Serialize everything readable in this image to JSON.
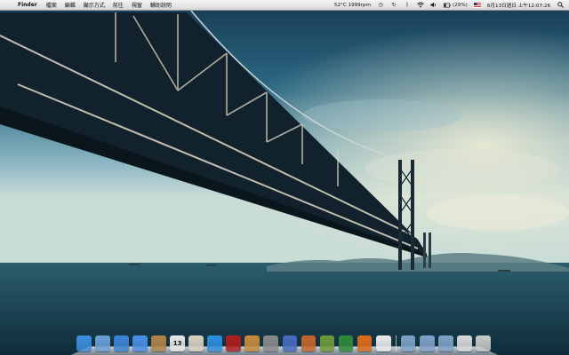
{
  "menubar": {
    "apple": "",
    "app_name": "Finder",
    "menus": [
      "檔案",
      "編輯",
      "顯示方式",
      "前往",
      "視窗",
      "輔助說明"
    ],
    "status_sensor": "52°C 1999rpm",
    "battery": "(29%)",
    "datetime": "6月13日週日 上午12:07:26"
  },
  "dock": {
    "apps": [
      {
        "name": "finder-icon",
        "color": "#3d8fe0"
      },
      {
        "name": "preview-icon",
        "color": "#6aa0d8"
      },
      {
        "name": "safari-icon",
        "color": "#3b84d6"
      },
      {
        "name": "ichat-icon",
        "color": "#4a8fe6"
      },
      {
        "name": "address-book-icon",
        "color": "#b0844a"
      },
      {
        "name": "ical-icon",
        "color": "#e8e8e8"
      },
      {
        "name": "iphoto-icon",
        "color": "#d9d2c0"
      },
      {
        "name": "itunes-icon",
        "color": "#2f8fe0"
      },
      {
        "name": "dvd-player-icon",
        "color": "#b01d1d"
      },
      {
        "name": "iphoto-library-icon",
        "color": "#c98b3d"
      },
      {
        "name": "system-preferences-icon",
        "color": "#8a8a8a"
      },
      {
        "name": "script-editor-icon",
        "color": "#4a6bbf"
      },
      {
        "name": "mail-stamp-icon",
        "color": "#c8652a"
      },
      {
        "name": "automator-icon",
        "color": "#6f9a3a"
      },
      {
        "name": "activity-monitor-icon",
        "color": "#2f8a3a"
      },
      {
        "name": "firefox-icon",
        "color": "#e06b1a"
      },
      {
        "name": "textedit-icon",
        "color": "#ececec"
      }
    ],
    "folders": [
      {
        "name": "applications-folder-icon",
        "color": "#7fa3c8"
      },
      {
        "name": "documents-folder-icon",
        "color": "#7fa3c8"
      },
      {
        "name": "downloads-folder-icon",
        "color": "#7fa3c8"
      },
      {
        "name": "screenshot-stack-icon",
        "color": "#d9d9d9"
      },
      {
        "name": "trash-icon",
        "color": "#c9c9c9"
      }
    ],
    "ical_day": "13"
  }
}
